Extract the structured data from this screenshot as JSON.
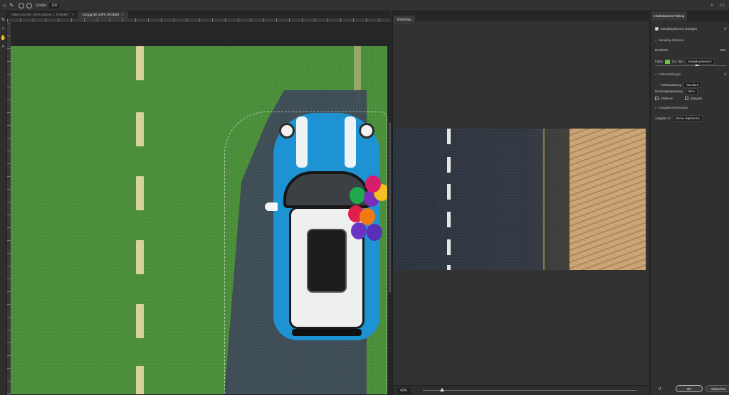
{
  "optionsbar": {
    "brush_label": "Größe:",
    "brush_size": "100"
  },
  "tabs": [
    {
      "label": "Mitten.psd bei 100% (Ebene 2, RGB/8#)",
      "close": "×"
    },
    {
      "label": "Car.jpg bei 100% (RGB/8)",
      "close": "×"
    }
  ],
  "preview": {
    "tab_label": "Vorschau",
    "zoom": "43%"
  },
  "props": {
    "title": "Inhaltsbasierte Füllung",
    "show_sampling": "Sampling-Bereich anzeigen",
    "sampling_options": "Sampling-Optionen",
    "opacity_label": "Deckkraft",
    "opacity_value": "69%",
    "color_label": "Farbe",
    "color_hint": "0,0 - Bei",
    "sampling_area": "Sampling-Bereich",
    "fill_settings": "Fülleinstellungen",
    "color_adapt_label": "Farbanpassung",
    "color_adapt_value": "Standard",
    "rotation_label": "Drehungsanpassung",
    "rotation_value": "Ohne",
    "scale_label": "Skalieren",
    "mirror_label": "Spiegeln",
    "output_settings": "Ausgabeeinstellungen",
    "output_label": "Ausgabe in:",
    "output_value": "Ebene duplizieren",
    "ok": "OK",
    "cancel": "Abbrechen"
  },
  "colors": {
    "sampling_swatch": "#6bc046",
    "canvas_green": "#4b8e3a"
  }
}
